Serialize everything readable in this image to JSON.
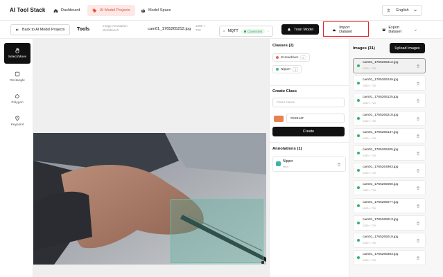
{
  "app": {
    "title": "AI Tool Stack"
  },
  "nav": {
    "tabs": [
      {
        "label": "Dashboard",
        "icon": "home-icon"
      },
      {
        "label": "AI Model Projects",
        "icon": "tag-icon",
        "active": true
      },
      {
        "label": "Model Space",
        "icon": "robot-icon"
      }
    ],
    "language": "English"
  },
  "toolbar": {
    "back_label": "Back to AI Model Projects",
    "tools_title": "Tools",
    "workspace_line1": "Image Annotation",
    "workspace_line2": "Workbench",
    "filename": "cam01_1765265212.jpg",
    "dims_line1": "1280 ×",
    "dims_line2": "720",
    "mqtt_label": "MQTT",
    "mqtt_status": "Connected",
    "train_label": "Train Model",
    "import_label": "Import Dataset",
    "export_label": "Export Dataset"
  },
  "palette": {
    "tools": [
      {
        "label": "Select/Move",
        "icon": "hand-icon",
        "active": true
      },
      {
        "label": "Rectangle",
        "icon": "rectangle-icon"
      },
      {
        "label": "Polygon",
        "icon": "polygon-icon"
      },
      {
        "label": "Keypoint",
        "icon": "pin-icon"
      }
    ]
  },
  "classes": {
    "title": "Classes (2)",
    "items": [
      {
        "label": "Screwdriver",
        "count": "0",
        "color": "#e26a5a"
      },
      {
        "label": "Nipper",
        "count": "1",
        "color": "#3fb3a5"
      }
    ]
  },
  "create_class": {
    "title": "Create Class",
    "placeholder": "Class Name",
    "color_hex": "#E8814F",
    "button_label": "Create"
  },
  "annotations": {
    "title": "Annotations (1)",
    "items": [
      {
        "label": "Nipper",
        "sub": "bbox",
        "color": "#3fb3a5"
      }
    ]
  },
  "images": {
    "title": "Images (31)",
    "upload_label": "Upload Images",
    "items": [
      {
        "name": "cam01_1765265212.jpg",
        "dims": "1280 × 720",
        "selected": true
      },
      {
        "name": "cam01_1765265249.jpg",
        "dims": "1280 × 720"
      },
      {
        "name": "cam01_1765265125.jpg",
        "dims": "1280 × 720"
      },
      {
        "name": "cam01_1765265218.jpg",
        "dims": "1280 × 720"
      },
      {
        "name": "cam01_1765265137.jpg",
        "dims": "1280 × 720"
      },
      {
        "name": "cam01_1765265205.jpg",
        "dims": "1280 × 720"
      },
      {
        "name": "cam01_1765264983.jpg",
        "dims": "1280 × 720"
      },
      {
        "name": "cam01_1765265050.jpg",
        "dims": "1280 × 720"
      },
      {
        "name": "cam01_1765265077.jpg",
        "dims": "1280 × 720"
      },
      {
        "name": "cam01_1765265013.jpg",
        "dims": "1280 × 720"
      },
      {
        "name": "cam01_1765265019.jpg",
        "dims": "1280 × 720"
      },
      {
        "name": "cam01_1765265383.jpg",
        "dims": "1280 × 720"
      }
    ]
  },
  "colors": {
    "accent": "#e0513f",
    "highlight_box": "#e02424",
    "bbox": "#5ec2ab",
    "connected": "#2f9e57"
  }
}
